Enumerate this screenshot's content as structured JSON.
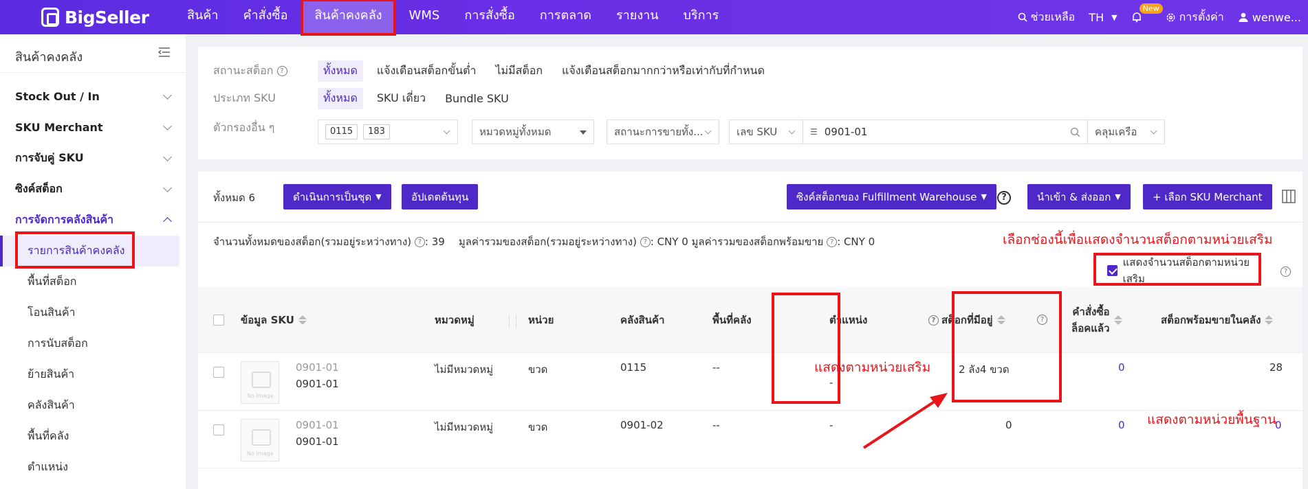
{
  "header": {
    "brand": "BigSeller",
    "nav": [
      "สินค้า",
      "คำสั่งซื้อ",
      "สินค้าคงคลัง",
      "WMS",
      "การสั่งซื้อ",
      "การตลาด",
      "รายงาน",
      "บริการ"
    ],
    "help": "ช่วยเหลือ",
    "lang": "TH",
    "new_badge": "New",
    "settings": "การตั้งค่า",
    "user": "wenwe..."
  },
  "sidebar": {
    "title": "สินค้าคงคลัง",
    "groups": [
      "Stock Out / In",
      "SKU Merchant",
      "การจับคู่ SKU",
      "ซิงค์สต็อก",
      "การจัดการคลังสินค้า"
    ],
    "items": [
      "รายการสินค้าคงคลัง",
      "พื้นที่สต็อก",
      "โอนสินค้า",
      "การนับสต็อก",
      "ย้ายสินค้า",
      "คลังสินค้า",
      "พื้นที่คลัง",
      "ตำแหน่ง"
    ]
  },
  "filters": {
    "stock_status": {
      "label": "สถานะสต็อก",
      "options": [
        "ทั้งหมด",
        "แจ้งเตือนสต็อกขั้นต่ำ",
        "ไม่มีสต็อก",
        "แจ้งเตือนสต็อกมากกว่าหรือเท่ากับที่กำหนด"
      ]
    },
    "sku_type": {
      "label": "ประเภท SKU",
      "options": [
        "ทั้งหมด",
        "SKU เดี่ยว",
        "Bundle SKU"
      ]
    },
    "other": {
      "label": "ตัวกรองอื่น ๆ",
      "warehouse_tags": [
        "0115",
        "183"
      ],
      "category": "หมวดหมู่ทั้งหมด",
      "sale_status": "สถานะการขายทั้ง...",
      "field": "เลข SKU",
      "search_value": "0901-01",
      "match": "คลุมเครือ"
    }
  },
  "toolbar": {
    "total": "ทั้งหมด 6",
    "bulk_action": "ดำเนินการเป็นชุด",
    "update_cost": "อัปเดตต้นทุน",
    "sync_fulfillment": "ซิงค์สต็อกของ Fulfillment Warehouse",
    "import_export": "นำเข้า & ส่งออก",
    "select_merchant": "+ เลือก SKU Merchant"
  },
  "summary": {
    "total_stock": "จำนวนทั้งหมดของสต็อก(รวมอยู่ระหว่างทาง)",
    "total_stock_value": ": 39",
    "total_value": "มูลค่ารวมของสต็อก(รวมอยู่ระหว่างทาง)",
    "total_value_val": ": CNY 0",
    "available_value": "มูลค่ารวมของสต็อกพร้อมขาย",
    "available_value_val": ": CNY 0"
  },
  "aux_unit_checkbox": "แสดงจำนวนสต็อกตามหน่วยเสริม",
  "table": {
    "headers": [
      "ข้อมูล SKU",
      "หมวดหมู่",
      "หน่วย",
      "คลังสินค้า",
      "พื้นที่คลัง",
      "ตำแหน่ง",
      "สต็อกที่มีอยู่",
      "คำสั่งซื้อ",
      "ล็อคแล้ว",
      "สต็อกพร้อมขายในคลัง"
    ],
    "rows": [
      {
        "sku_a": "0901-01",
        "sku_b": "0901-01",
        "img": "No Image",
        "category": "ไม่มีหมวดหมู่",
        "unit": "ขวด",
        "warehouse": "0115",
        "zone": "--",
        "location": "-",
        "stock": "2 ลัง4 ขวด",
        "locked": "0",
        "available": "28"
      },
      {
        "sku_a": "0901-01",
        "sku_b": "0901-01",
        "img": "No Image",
        "category": "ไม่มีหมวดหมู่",
        "unit": "ขวด",
        "warehouse": "0901-02",
        "zone": "--",
        "location": "-",
        "stock": "0",
        "locked": "0",
        "available": "0"
      }
    ]
  },
  "annotations": {
    "select_checkbox": "เลือกช่องนี้เพื่อแสดงจำนวนสต็อกตามหน่วยเสริม",
    "aux_unit": "แสดงตามหน่วยเสริม",
    "base_unit": "แสดงตามหน่วยพื้นฐาน"
  },
  "colors": {
    "brand": "#5b2ce0",
    "accent": "#4e29c8",
    "annotation": "#e8161b"
  }
}
